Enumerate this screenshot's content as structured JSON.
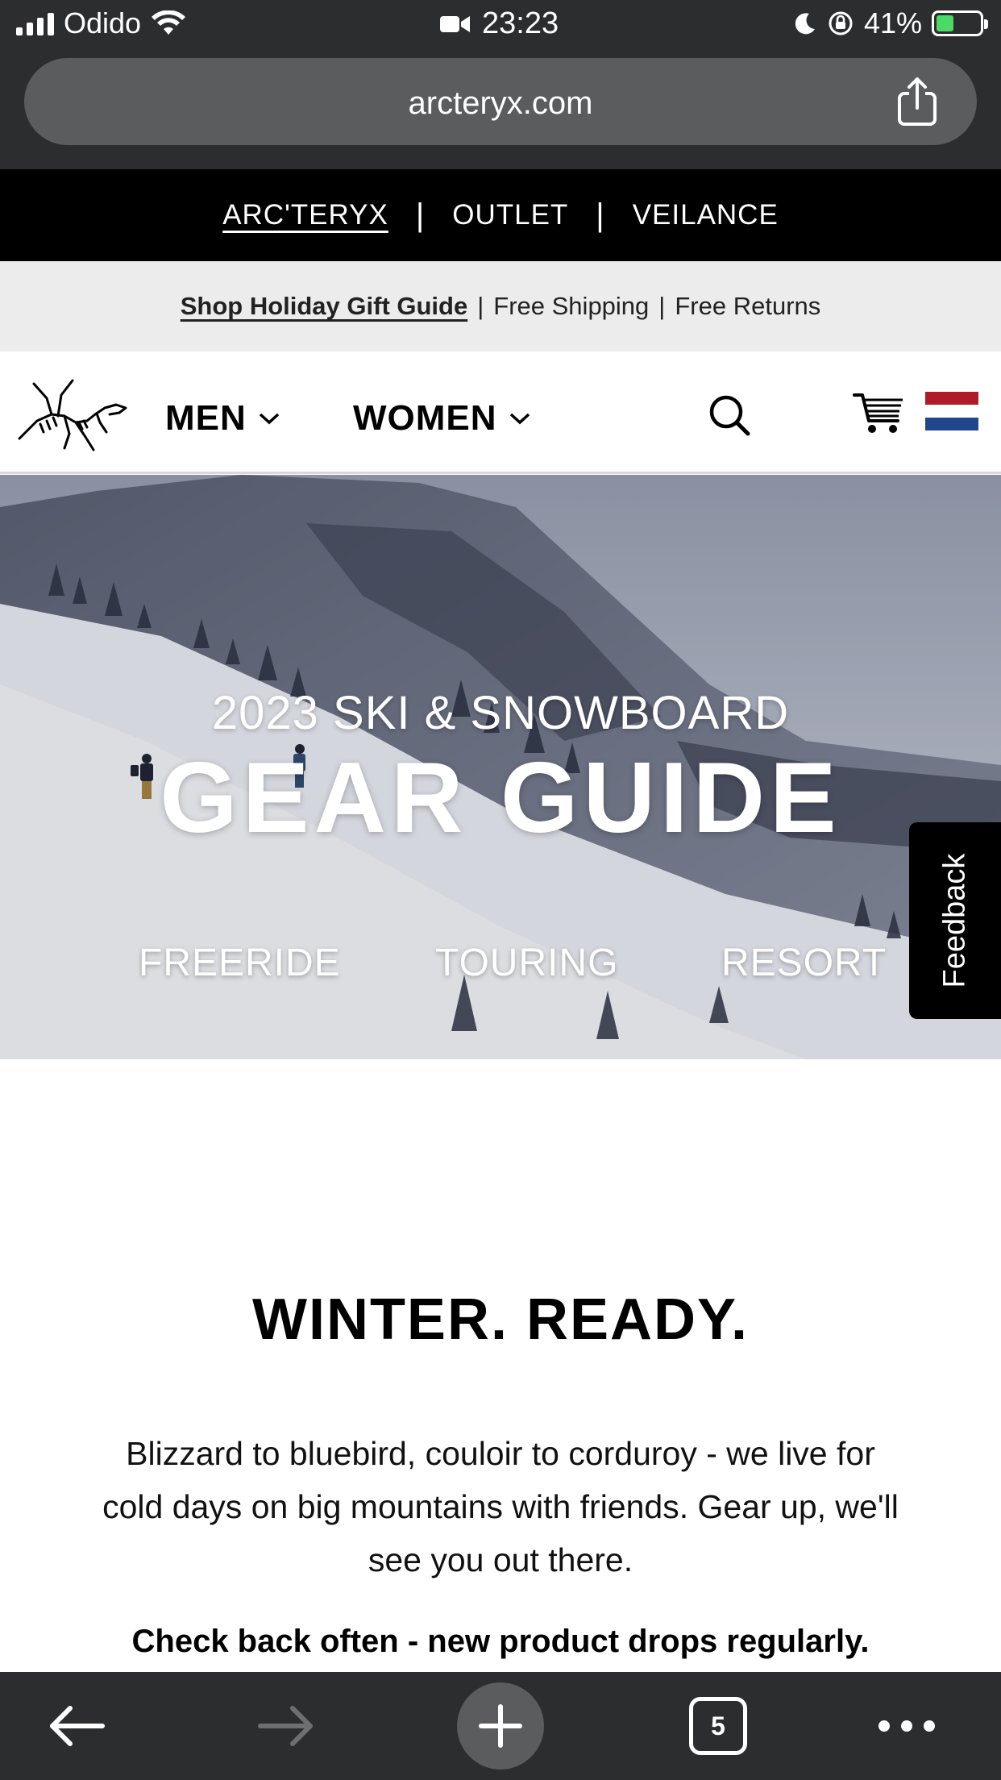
{
  "status_bar": {
    "carrier": "Odido",
    "time": "23:23",
    "battery": "41%"
  },
  "browser": {
    "url": "arcteryx.com"
  },
  "brand_bar": {
    "items": [
      "ARC'TERYX",
      "OUTLET",
      "VEILANCE"
    ]
  },
  "promo_bar": {
    "gift_link": "Shop Holiday Gift Guide",
    "shipping": "Free Shipping",
    "returns": "Free Returns"
  },
  "nav": {
    "men": "MEN",
    "women": "WOMEN"
  },
  "hero": {
    "subtitle": "2023 SKI & SNOWBOARD",
    "title": "GEAR GUIDE",
    "links": [
      "FREERIDE",
      "TOURING",
      "RESORT"
    ]
  },
  "feedback": "Feedback",
  "content": {
    "heading": "WINTER. READY.",
    "body": "Blizzard to bluebird, couloir to corduroy - we live for cold days on big mountains with friends. Gear up, we'll see you out there.",
    "note": "Check back often - new product drops regularly."
  },
  "toolbar": {
    "tab_count": "5"
  },
  "colors": {
    "browser_chrome": "#2c2d2f",
    "url_pill": "#5b5c5e",
    "brand_bar": "#000000",
    "promo_bar": "#ececec",
    "flag_red": "#ae1c28",
    "flag_blue": "#21468b"
  }
}
